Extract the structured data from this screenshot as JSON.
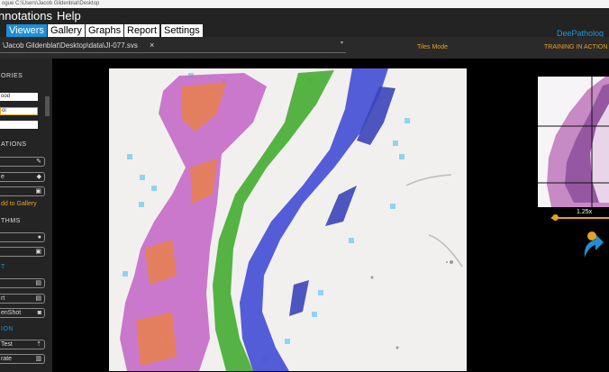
{
  "window": {
    "title": "ogue C:\\Users\\Jacob Gildenblat\\Desktop"
  },
  "menu": {
    "annotations": "nnotations",
    "help": "Help"
  },
  "tabs": [
    {
      "label": "Viewers",
      "active": true
    },
    {
      "label": "Gallery",
      "active": false
    },
    {
      "label": "Graphs",
      "active": false
    },
    {
      "label": "Report",
      "active": false
    },
    {
      "label": "Settings",
      "active": false
    }
  ],
  "brand": "DeePatholog",
  "path": {
    "text": "\\Jacob Gildenblat\\Desktop\\data\\JI-077.svs",
    "close": "×"
  },
  "status": {
    "mode": "Tiles Mode",
    "training": "TRAINING IN ACTION"
  },
  "sidebar": {
    "categories_header": "ORIES",
    "category_fields": [
      "ood",
      "ol",
      ""
    ],
    "annotations_header": "ATIONS",
    "annotation_buttons": [
      "",
      "e",
      ""
    ],
    "add_gallery": "dd to Gallery",
    "algorithms_header": "THMS",
    "algorithm_buttons": [
      "",
      ""
    ],
    "blue_header_1": "T",
    "export_buttons": [
      "",
      "rt",
      "enShot"
    ],
    "blue_header_2": "ION",
    "test_buttons": [
      "Test",
      "rate"
    ]
  },
  "viewer": {
    "zoom": "1.25x",
    "zoom_fraction": 0.05
  },
  "colors": {
    "accent_blue": "#1e8fd6",
    "accent_orange": "#e6a11f",
    "tissue_green": "#4caf3a",
    "tissue_blue": "#4a54d6",
    "tissue_magenta": "#c46ac8",
    "tissue_orange": "#e8804a",
    "tissue_cyan": "#8fd4f0"
  }
}
